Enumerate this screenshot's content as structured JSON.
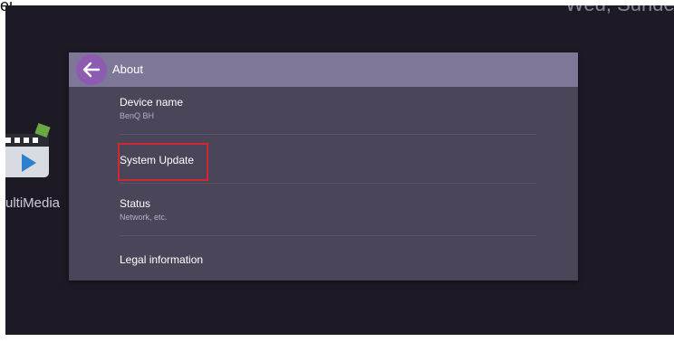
{
  "top_left_text": "ej",
  "clock_date": "Wed, Sunde",
  "desktop": {
    "multimedia_label": "ultiMedia"
  },
  "dialog": {
    "title": "About",
    "items": [
      {
        "title": "Device name",
        "subtitle": "BenQ BH"
      },
      {
        "title": "System Update",
        "subtitle": ""
      },
      {
        "title": "Status",
        "subtitle": "Network, etc."
      },
      {
        "title": "Legal information",
        "subtitle": ""
      }
    ]
  },
  "colors": {
    "highlight": "#d42532",
    "header": "#7f7798",
    "back_button": "#8d5bb0"
  },
  "icons": [
    "back-arrow-icon",
    "multimedia-icon"
  ]
}
